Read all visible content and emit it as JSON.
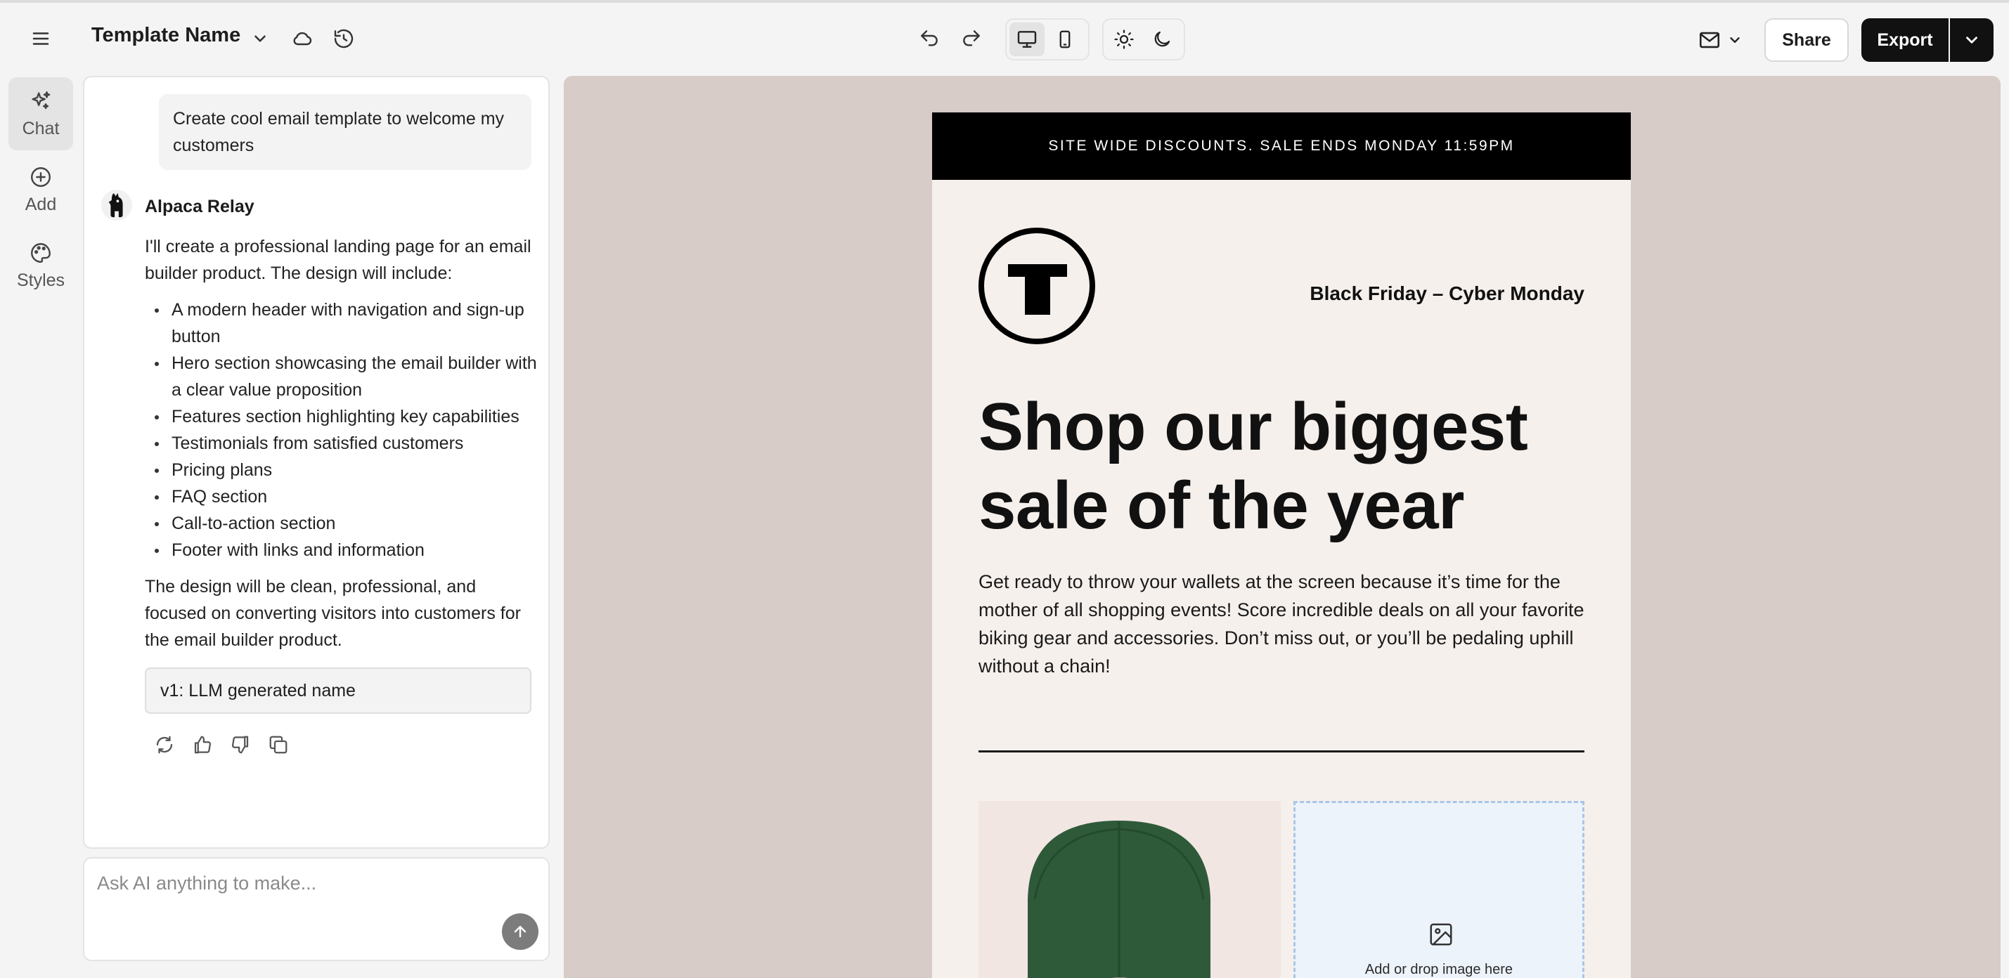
{
  "topbar": {
    "template_name": "Template Name",
    "share_label": "Share",
    "export_label": "Export"
  },
  "rail": [
    {
      "label": "Chat",
      "icon": "sparkles-icon",
      "active": true
    },
    {
      "label": "Add",
      "icon": "plus-circle-icon",
      "active": false
    },
    {
      "label": "Styles",
      "icon": "palette-icon",
      "active": false
    }
  ],
  "chat": {
    "user_message": "Create cool email template to welcome my customers",
    "ai_name": "Alpaca Relay",
    "ai_intro": "I'll create a professional landing page for an email builder product. The design will include:",
    "ai_list": [
      "A modern header with navigation and sign-up button",
      "Hero section showcasing the email builder with a clear value proposition",
      "Features section highlighting key capabilities",
      "Testimonials from satisfied customers",
      "Pricing plans",
      "FAQ section",
      "Call-to-action section",
      "Footer with links and information"
    ],
    "ai_outro": "The design will be clean, professional, and focused on converting visitors into customers for the email builder product.",
    "version_chip": "v1: LLM generated name",
    "input_placeholder": "Ask AI anything to make..."
  },
  "email": {
    "banner": "SITE WIDE DISCOUNTS. SALE ENDS MONDAY 11:59PM",
    "bf_label": "Black Friday – Cyber Monday",
    "headline": "Shop our biggest sale of the year",
    "body": "Get ready to throw your wallets at the screen because it’s time for the mother of all shopping events! Score incredible deals on all your favorite biking gear and accessories. Don’t miss out, or you’ll be pedaling uphill without a chain!",
    "dropzone_text": "Add or drop image here"
  },
  "colors": {
    "canvas_bg": "#d7ccc8",
    "email_bg": "#f6f0ec",
    "export_bg": "#111111",
    "dropzone_border": "#a9c6e6",
    "cap_green": "#2f5a3a"
  }
}
